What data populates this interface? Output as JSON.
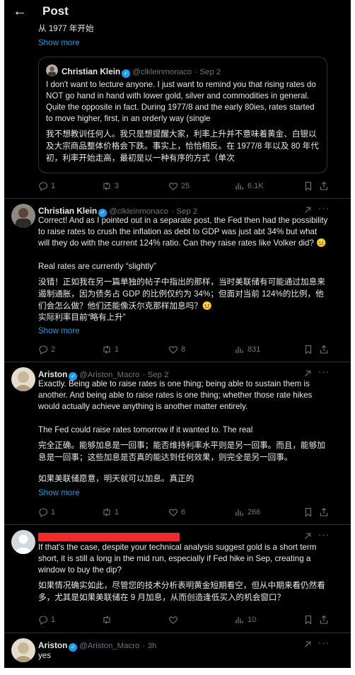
{
  "header": {
    "back_icon": "arrow-left-icon",
    "title": "Post"
  },
  "top_partial_text": "从 1977 年开始",
  "show_more": "Show more",
  "quote": {
    "name": "Christian Klein",
    "handle": "@clkleinmonaco",
    "date": "· Sep 2",
    "text_en": "I don't want to lecture anyone. I just want to remind you that rising rates do NOT go hand in hand with lower gold, silver and commodities in general. Quite the opposite in fact. During 1977/8 and the early 80ies, rates started to move higher, first, in an orderly way (single",
    "text_cn": "我不想教训任何人。我只是想提醒大家，利率上升并不意味着黄金、白银以及大宗商品整体价格会下跌。事实上，恰恰相反。在 1977/8 年以及 80 年代初，利率开始走高，最初是以一种有序的方式（单次"
  },
  "quote_actions": {
    "reply": "1",
    "repost": "3",
    "like": "25",
    "views": "6.1K"
  },
  "reply1": {
    "name": "Christian Klein",
    "handle": "@clkleinmonaco",
    "date": "· Sep 2",
    "text_en": "Correct! And as I pointed out in a separate post, the Fed then had the possibility to raise rates to crush the inflation as debt to GDP was just abt 34% but what will they do with the current 124% ratio. Can they raise rates like Volker did? 😐",
    "text_en2": "Real rates are currently “slightly”",
    "text_cn": "没错！正如我在另一篇单独的帖子中指出的那样，当时美联储有可能通过加息来遏制通胀，因为债务占 GDP 的比例仅约为 34%；但面对当前 124%的比例，他们会怎么做？他们还能像沃尔克那样加息吗？😐",
    "text_cn2": "实际利率目前“略有上升”",
    "show_more": "Show more",
    "actions": {
      "reply": "2",
      "repost": "1",
      "like": "8",
      "views": "831"
    }
  },
  "reply2": {
    "name": "Ariston",
    "handle": "@Ariston_Macro",
    "date": "· Sep 2",
    "text_en": "Exactly. Being able to raise rates is one thing; being able to sustain them is another. And being able to raise rates is one thing; whether those rate hikes would actually achieve anything is another matter entirely.",
    "text_en2": "The Fed could raise rates tomorrow if it wanted to. The real",
    "text_cn": "完全正确。能够加息是一回事；能否维持利率水平则是另一回事。而且，能够加息是一回事；这些加息是否真的能达到任何效果，则完全是另一回事。",
    "text_cn2": "如果美联储愿意，明天就可以加息。真正的",
    "show_more": "Show more",
    "actions": {
      "reply": "1",
      "repost": "1",
      "like": "6",
      "views": "266"
    }
  },
  "reply3": {
    "text_en": "If that's the case, despite your technical analysis suggest gold is a short term short, it is still a long in the mid run, especially if Fed hike in Sep, creating a window to buy the dip?",
    "text_cn": "如果情况确实如此，尽管您的技术分析表明黄金短期看空，但从中期来看仍然看多，尤其是如果美联储在 9 月加息，从而创造逢低买入的机会窗口？",
    "actions": {
      "reply": "1",
      "repost": "",
      "like": "",
      "views": "10"
    }
  },
  "reply4": {
    "name": "Ariston",
    "handle": "@Ariston_Macro",
    "date": "· 3h",
    "text": "yes"
  },
  "colors": {
    "accent": "#1d9bf0",
    "background": "#000000",
    "muted": "#71767b",
    "redaction": "#ef2b2b"
  }
}
